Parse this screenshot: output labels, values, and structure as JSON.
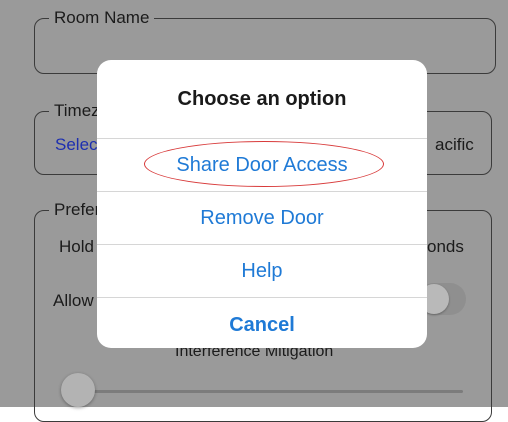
{
  "form": {
    "room_name": {
      "legend": "Room Name",
      "value": ""
    },
    "timezone": {
      "legend": "Timez",
      "value_left": "Selec",
      "value_right": "acific"
    },
    "preferences": {
      "legend": "Prefer",
      "hold_left": "Hold",
      "hold_right": "onds",
      "allow_left": "Allow",
      "interference_label": "Interference Mitigation"
    }
  },
  "modal": {
    "title": "Choose an option",
    "options": [
      {
        "label": "Share Door Access",
        "highlighted": true
      },
      {
        "label": "Remove Door"
      },
      {
        "label": "Help"
      }
    ],
    "cancel_label": "Cancel"
  },
  "colors": {
    "accent": "#1f7ad6",
    "highlight_ring": "#d83a3a",
    "background_dim": "#9a9a9a"
  }
}
